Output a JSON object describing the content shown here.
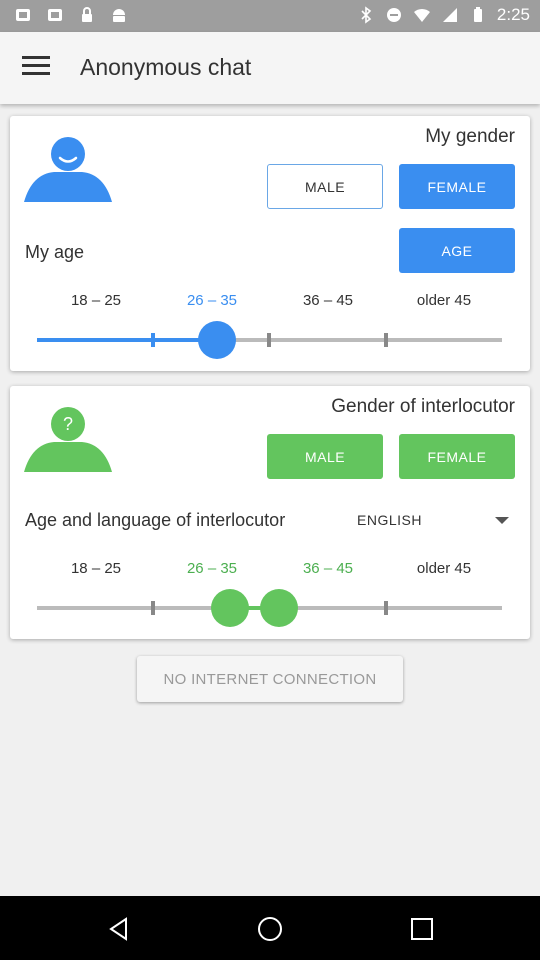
{
  "status_bar": {
    "time": "2:25",
    "left_icons": [
      "notification-icon-1",
      "notification-icon-2",
      "lock-icon",
      "android-icon"
    ],
    "right_icons": [
      "bluetooth-icon",
      "dnd-icon",
      "wifi-icon",
      "signal-icon",
      "battery-icon"
    ]
  },
  "app_bar": {
    "title": "Anonymous chat"
  },
  "my_section": {
    "gender_heading": "My gender",
    "male_label": "MALE",
    "female_label": "FEMALE",
    "age_label": "My age",
    "age_button": "AGE",
    "ranges": [
      "18 – 25",
      "26 – 35",
      "36 – 45",
      "older 45"
    ],
    "selected_index": 1,
    "accent_color": "#3a8ef0"
  },
  "interlocutor_section": {
    "gender_heading": "Gender of interlocutor",
    "male_label": "MALE",
    "female_label": "FEMALE",
    "age_lang_label": "Age and language of interlocutor",
    "language": "ENGLISH",
    "ranges": [
      "18 – 25",
      "26 – 35",
      "36 – 45",
      "older 45"
    ],
    "selected_indices": [
      1,
      2
    ],
    "accent_color": "#63c55e",
    "avatar_badge": "?"
  },
  "status_message": "NO INTERNET CONNECTION"
}
